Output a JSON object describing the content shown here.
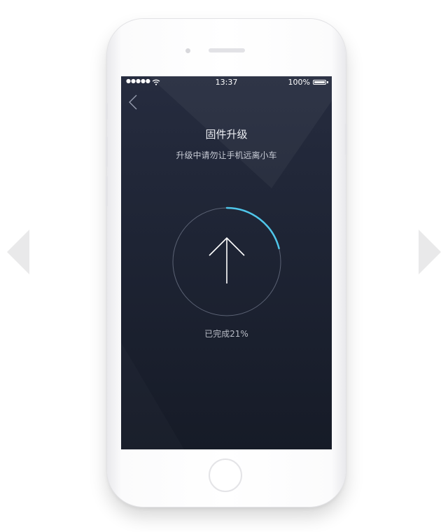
{
  "status_bar": {
    "time": "13:37",
    "battery": "100%"
  },
  "header": {
    "title": "固件升级",
    "subtitle": "升级中请勿让手机远离小车"
  },
  "progress": {
    "percent": 21,
    "label": "已完成21%"
  },
  "colors": {
    "screen_top": "#262c3f",
    "screen_bottom": "#161b27",
    "progress_accent": "#4fc6ea",
    "ring": "#5c6375"
  },
  "icons": [
    "back-chevron-icon",
    "upload-arrow-icon",
    "wifi-icon",
    "battery-icon"
  ]
}
